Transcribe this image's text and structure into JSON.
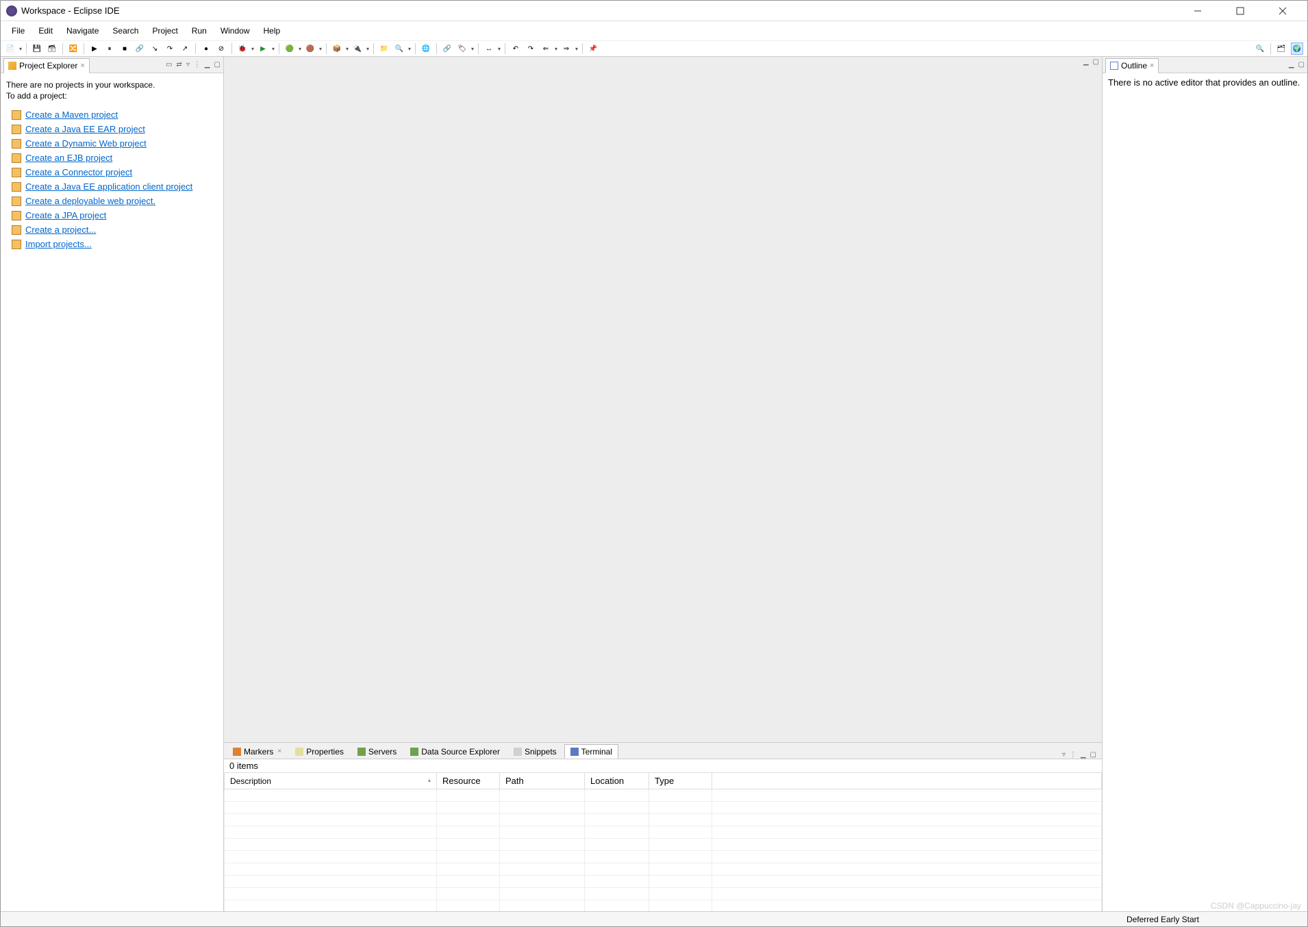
{
  "window": {
    "title": "Workspace - Eclipse IDE"
  },
  "menu": {
    "items": [
      "File",
      "Edit",
      "Navigate",
      "Search",
      "Project",
      "Run",
      "Window",
      "Help"
    ]
  },
  "projectExplorer": {
    "tabLabel": "Project Explorer",
    "emptyLine1": "There are no projects in your workspace.",
    "emptyLine2": "To add a project:",
    "links": [
      "Create a Maven project",
      "Create a Java EE EAR project",
      "Create a Dynamic Web project",
      "Create an EJB project",
      "Create a Connector project",
      "Create a Java EE application client project",
      "Create a deployable web project.",
      "Create a JPA project",
      "Create a project...",
      "Import projects..."
    ]
  },
  "outline": {
    "tabLabel": "Outline",
    "message": "There is no active editor that provides an outline."
  },
  "bottom": {
    "tabs": [
      "Markers",
      "Properties",
      "Servers",
      "Data Source Explorer",
      "Snippets",
      "Terminal"
    ],
    "activeTabIndex": 5,
    "itemsSummary": "0 items",
    "columns": [
      "Description",
      "Resource",
      "Path",
      "Location",
      "Type"
    ]
  },
  "statusbar": {
    "message": "Deferred Early Start"
  },
  "watermark": "CSDN @Cappuccino-jay"
}
